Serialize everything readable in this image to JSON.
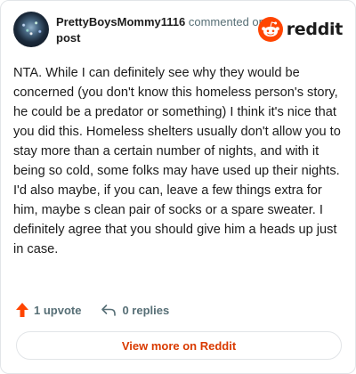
{
  "header": {
    "username": "PrettyBoysMommy1116",
    "action": "commented on",
    "post_link": "post",
    "brand_wordmark": "reddit"
  },
  "comment": {
    "text": "NTA. While I can definitely see why they would be concerned (you don't know this homeless person's story, he could be a predator or something) I think it's nice that you did this. Homeless shelters usually don't allow you to stay more than a certain number of nights, and with it being so cold, some folks may have used up their nights. I'd also maybe, if you can, leave a few things extra for him, maybe s clean pair of socks or a spare sweater. I definitely agree that you should give him a heads up just in case."
  },
  "footer": {
    "upvotes": "1 upvote",
    "replies": "0 replies"
  },
  "view_more_label": "View more on Reddit",
  "colors": {
    "brand_orange": "#ff4500",
    "link_orange": "#d93a00",
    "muted_text": "#576f76"
  },
  "icons": {
    "avatar": "avatar",
    "brand": "reddit-snoo-icon",
    "upvote": "upvote-arrow-icon",
    "reply": "reply-arrow-icon"
  }
}
